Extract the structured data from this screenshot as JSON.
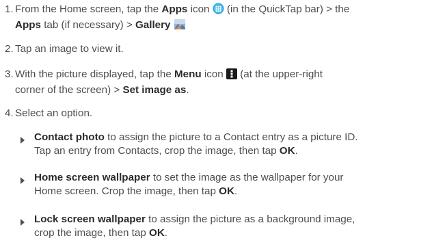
{
  "steps": [
    {
      "num": "1.",
      "l1a": "From the Home screen, tap the ",
      "apps": "Apps",
      "l1b": " icon ",
      "l1c": " (in the QuickTap bar) > the",
      "apps_tab": "Apps",
      "l2a": " tab (if necessary) > ",
      "gallery": "Gallery",
      "icons": [
        "apps-icon",
        "gallery-icon"
      ]
    },
    {
      "num": "2.",
      "text": "Tap an image to view it."
    },
    {
      "num": "3.",
      "l1a": "With the picture displayed, tap the ",
      "menu": "Menu",
      "l1b": " icon ",
      "l1c": " (at the upper-right",
      "l2a": "corner of the screen) > ",
      "set_as": "Set image as",
      "l2b": ".",
      "icons": [
        "menu-icon"
      ]
    },
    {
      "num": "4.",
      "text": "Select an option."
    }
  ],
  "options": [
    {
      "title": "Contact photo",
      "l1": " to assign the picture to a Contact entry as a picture ID.",
      "l2a": "Tap an entry from Contacts, crop the image, then tap ",
      "ok": "OK",
      "end": "."
    },
    {
      "title": "Home screen wallpaper",
      "l1": " to set the image as the wallpaper for your",
      "l2a": "Home screen. Crop the image, then tap ",
      "ok": "OK",
      "end": "."
    },
    {
      "title": "Lock screen wallpaper",
      "l1": " to assign the picture as a background image,",
      "l2a": "crop the image, then tap ",
      "ok": "OK",
      "end": "."
    }
  ],
  "colors": {
    "text": "#4d4d4d",
    "bold": "#2b2b2b",
    "apps_icon": "#2aa3d8",
    "menu_icon": "#1a1a1a"
  }
}
